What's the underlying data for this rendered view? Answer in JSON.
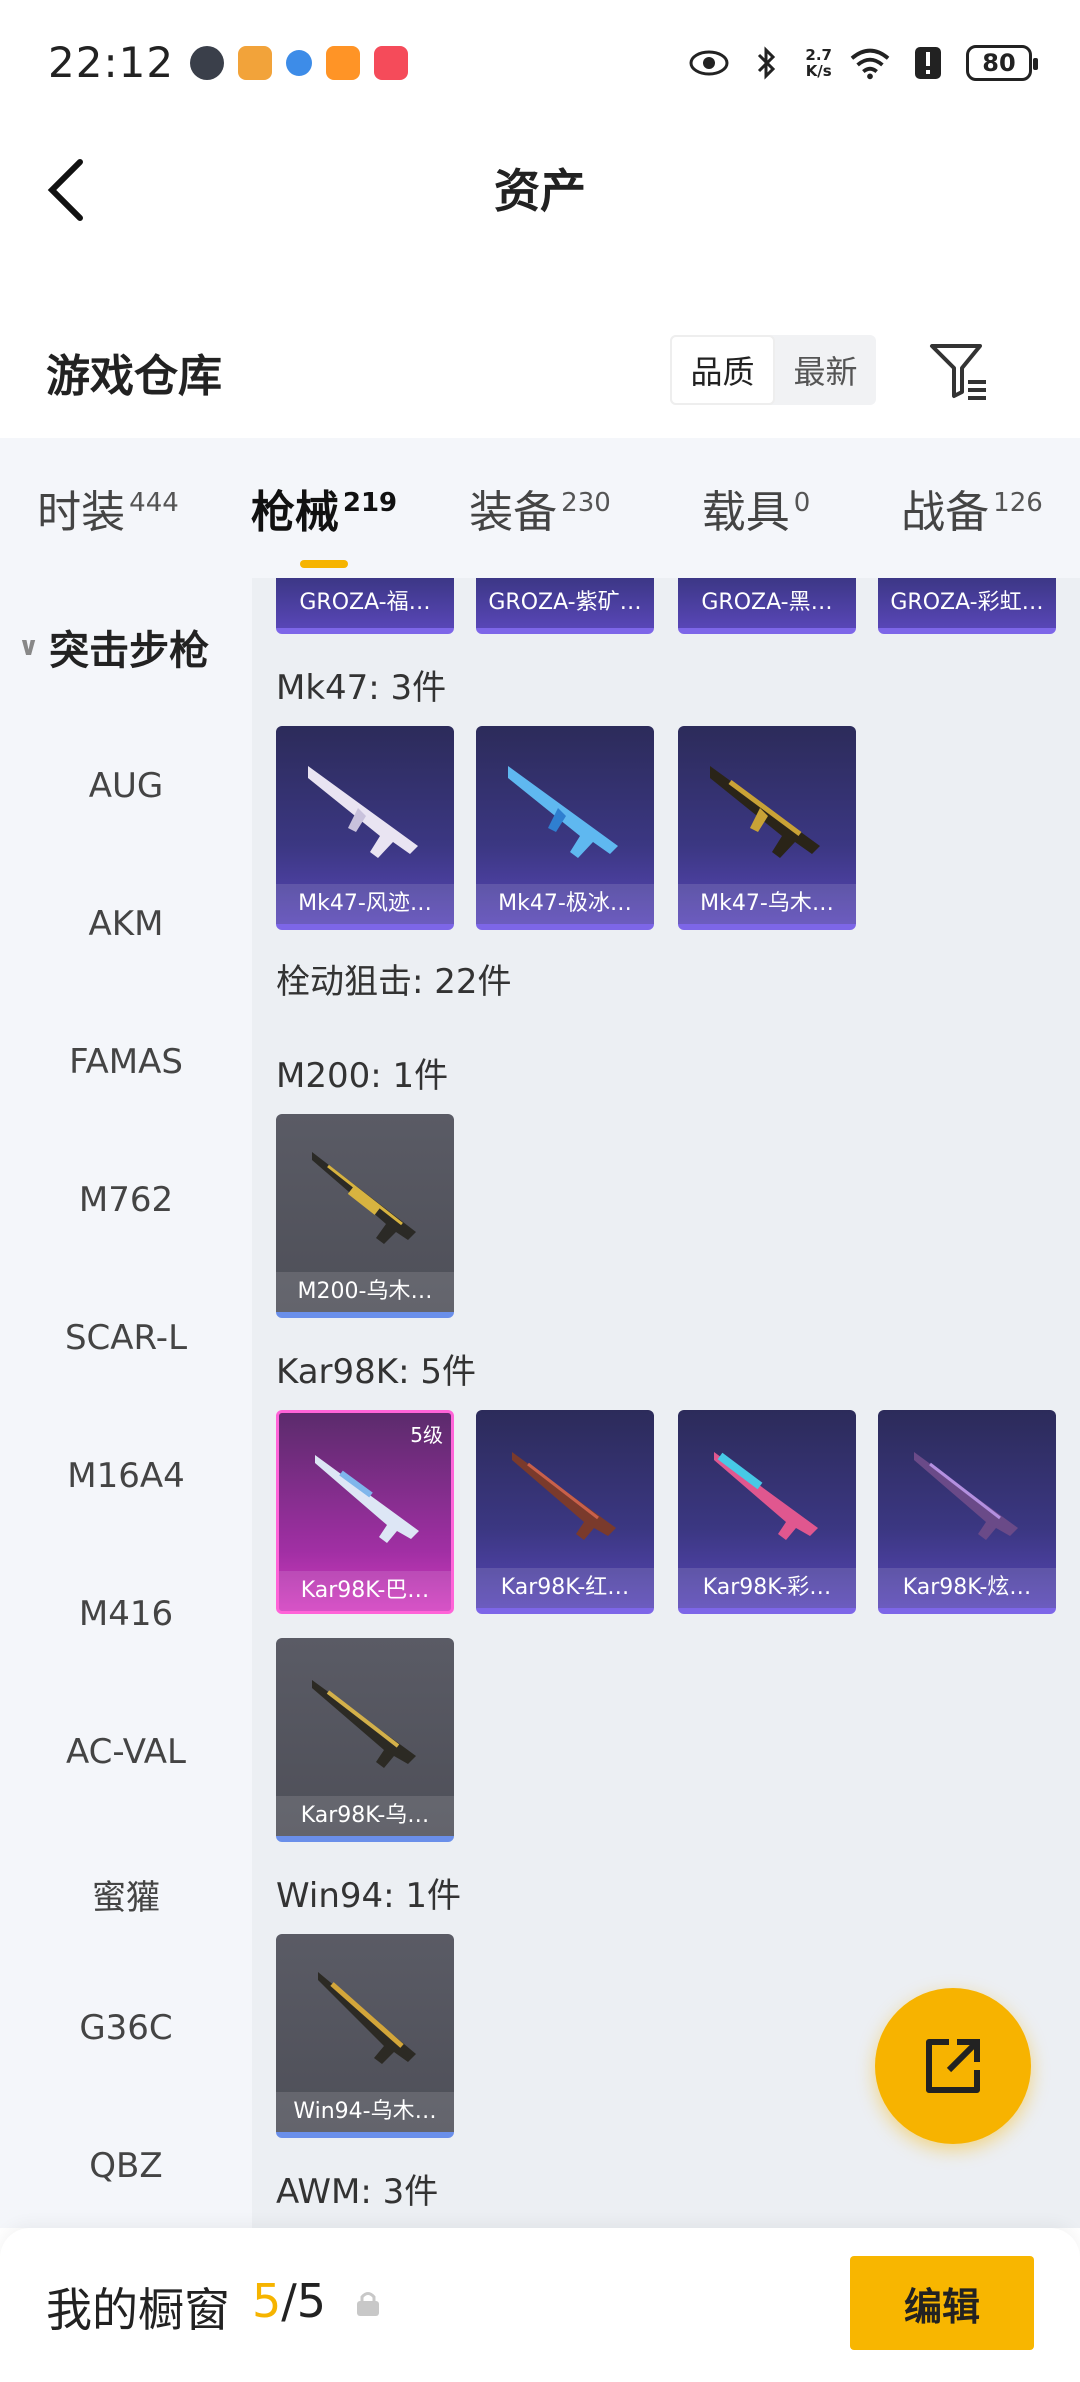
{
  "status_bar": {
    "time": "22:12",
    "net_speed_top": "2.7",
    "net_speed_bottom": "K/s",
    "battery": "80",
    "app_icons": [
      "game-avatar-icon",
      "orange-app-icon",
      "blue-app-icon",
      "gamepad-app-icon",
      "red-shop-icon"
    ]
  },
  "header": {
    "title": "资产"
  },
  "section": {
    "title": "游戏仓库",
    "sort_options": [
      "品质",
      "最新"
    ],
    "active_sort": "品质"
  },
  "tabs": [
    {
      "label": "时装",
      "count": "444"
    },
    {
      "label": "枪械",
      "count": "219"
    },
    {
      "label": "装备",
      "count": "230"
    },
    {
      "label": "载具",
      "count": "0"
    },
    {
      "label": "战备",
      "count": "126"
    }
  ],
  "sidebar": {
    "category": "突击步枪",
    "items": [
      "AUG",
      "AKM",
      "FAMAS",
      "M762",
      "SCAR-L",
      "M16A4",
      "M416",
      "AC-VAL",
      "蜜獾",
      "G36C",
      "QBZ"
    ]
  },
  "main": {
    "top_cards": [
      "GROZA-福…",
      "GROZA-紫矿…",
      "GROZA-黑…",
      "GROZA-彩虹…"
    ],
    "mk47_label": "Mk47: 3件",
    "mk47_cards": [
      "Mk47-风迹…",
      "Mk47-极冰…",
      "Mk47-乌木…"
    ],
    "bolt_label": "栓动狙击: 22件",
    "m200_label": "M200: 1件",
    "m200_cards": [
      "M200-乌木…"
    ],
    "kar_label": "Kar98K: 5件",
    "kar_cards": [
      "Kar98K-巴…",
      "Kar98K-红…",
      "Kar98K-彩…",
      "Kar98K-炫…",
      "Kar98K-乌…"
    ],
    "kar_level": "5级",
    "win_label": "Win94: 1件",
    "win_cards": [
      "Win94-乌木…"
    ],
    "awm_label": "AWM: 3件"
  },
  "bottom": {
    "label": "我的橱窗",
    "count_current": "5",
    "count_total": "/5",
    "edit_label": "编辑"
  },
  "colors": {
    "accent": "#f6b400",
    "purple_card": "#3b3782",
    "gray_card": "#52535c",
    "pink_card": "#a12fa4"
  }
}
